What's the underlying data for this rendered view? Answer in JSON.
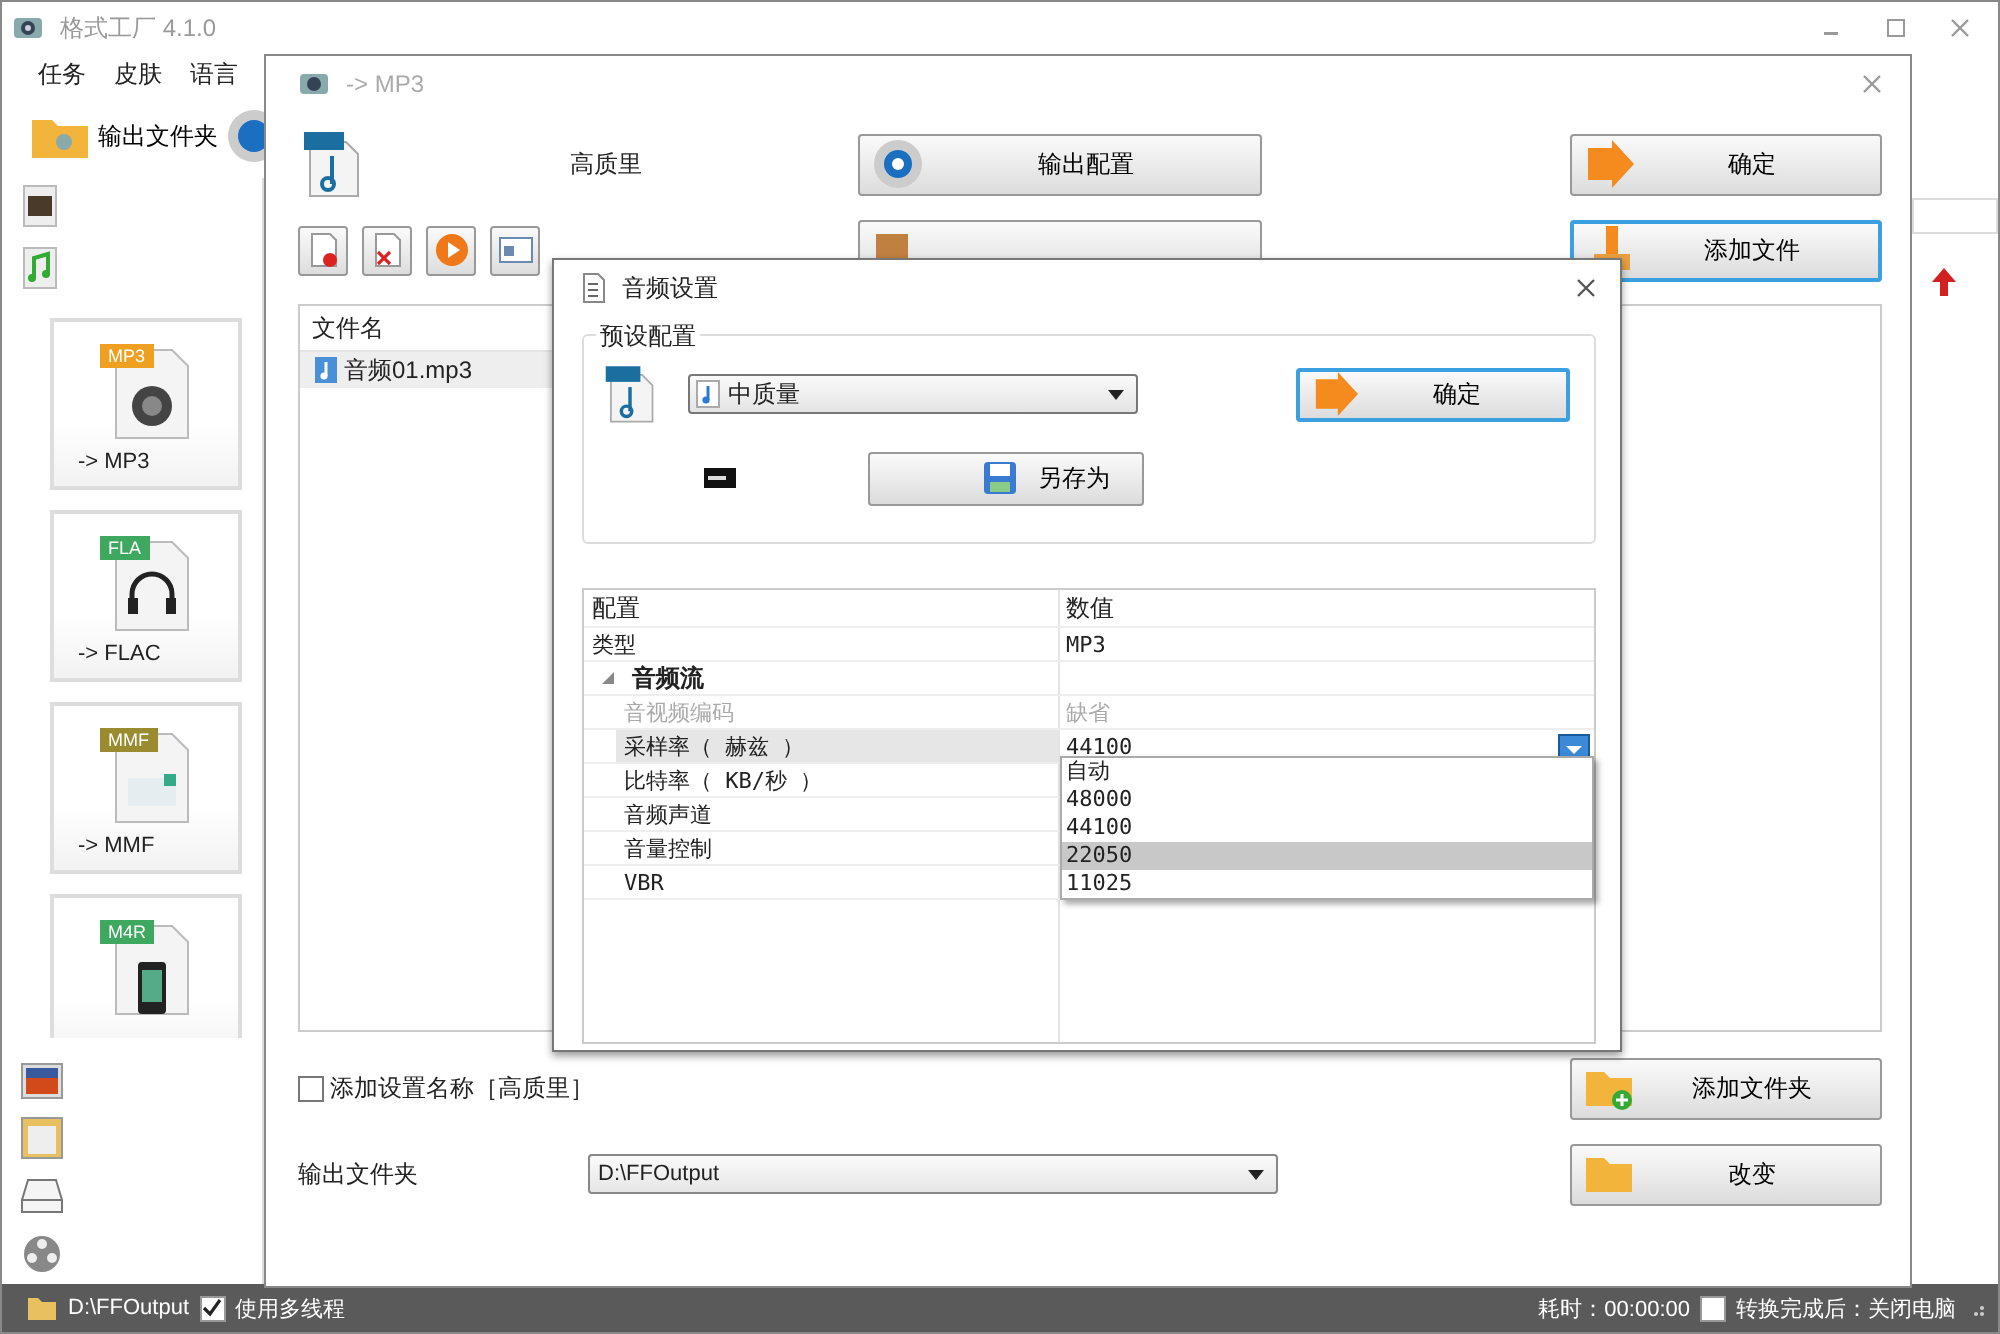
{
  "main_window": {
    "title": "格式工厂 4.1.0",
    "menu": [
      "任务",
      "皮肤",
      "语言"
    ],
    "toolbar": {
      "output_folder": "输出文件夹"
    },
    "formats": [
      {
        "label": "-> MP3",
        "tag": "MP3",
        "color": "#f0a020",
        "kind": "speaker"
      },
      {
        "label": "-> FLAC",
        "tag": "FLA",
        "color": "#3fa860",
        "kind": "headphones"
      },
      {
        "label": "-> MMF",
        "tag": "MMF",
        "color": "#9a8a30",
        "kind": "mail"
      },
      {
        "tag": "M4R",
        "color": "#3fa860",
        "kind": "phone"
      }
    ],
    "status_bar": {
      "output_path": "D:\\FFOutput",
      "multithread": {
        "label": "使用多线程",
        "checked": true
      },
      "elapsed": "耗时：00:00:00",
      "shutdown": {
        "label": "转换完成后：关闭电脑",
        "checked": false
      }
    }
  },
  "format_dialog": {
    "title": "-> MP3",
    "quality": "高质里",
    "output_config": "输出配置",
    "top_buttons": [
      {
        "label": "确定",
        "focused": false
      },
      {
        "label": "添加文件",
        "focused": true
      }
    ],
    "file_list": {
      "column": "文件名",
      "rows": [
        {
          "name": "音频01.mp3",
          "selected": true
        }
      ]
    },
    "add_name": {
      "label": "添加设置名称［高质里］",
      "checked": false
    },
    "bottom_buttons": [
      {
        "label": "添加文件夹",
        "focused": false
      },
      {
        "label": "改变",
        "focused": false
      }
    ],
    "output_folder": {
      "label": "输出文件夹",
      "value": "D:\\FFOutput"
    }
  },
  "audio_dialog": {
    "title": "音频设置",
    "preset": {
      "label": "预设配置",
      "value": "中质量",
      "ok": {
        "label": "确定",
        "focused": true
      },
      "save_as": "另存为"
    },
    "grid": {
      "columns": [
        "配置",
        "数值"
      ],
      "rows": [
        {
          "name": "类型",
          "value": "MP3",
          "selected": false,
          "disabled": false
        },
        {
          "name": "音频流",
          "expanded": true,
          "children": [
            {
              "name": "音视频编码",
              "value": "缺省",
              "selected": false,
              "disabled": true
            },
            {
              "name": "采样率（ 赫兹 ）",
              "value": "44100",
              "selected": true,
              "disabled": false
            },
            {
              "name": "比特率（ KB/秒 ）",
              "selected": false,
              "disabled": false
            },
            {
              "name": "音频声道",
              "selected": false,
              "disabled": false
            },
            {
              "name": "音量控制",
              "selected": false,
              "disabled": false
            },
            {
              "name": "VBR",
              "selected": false,
              "disabled": false
            }
          ]
        }
      ]
    },
    "dropdown": [
      {
        "label": "自动",
        "selected": false
      },
      {
        "label": "48000",
        "selected": false
      },
      {
        "label": "44100",
        "selected": false
      },
      {
        "label": "22050",
        "selected": true
      },
      {
        "label": "11025",
        "selected": false
      }
    ]
  }
}
